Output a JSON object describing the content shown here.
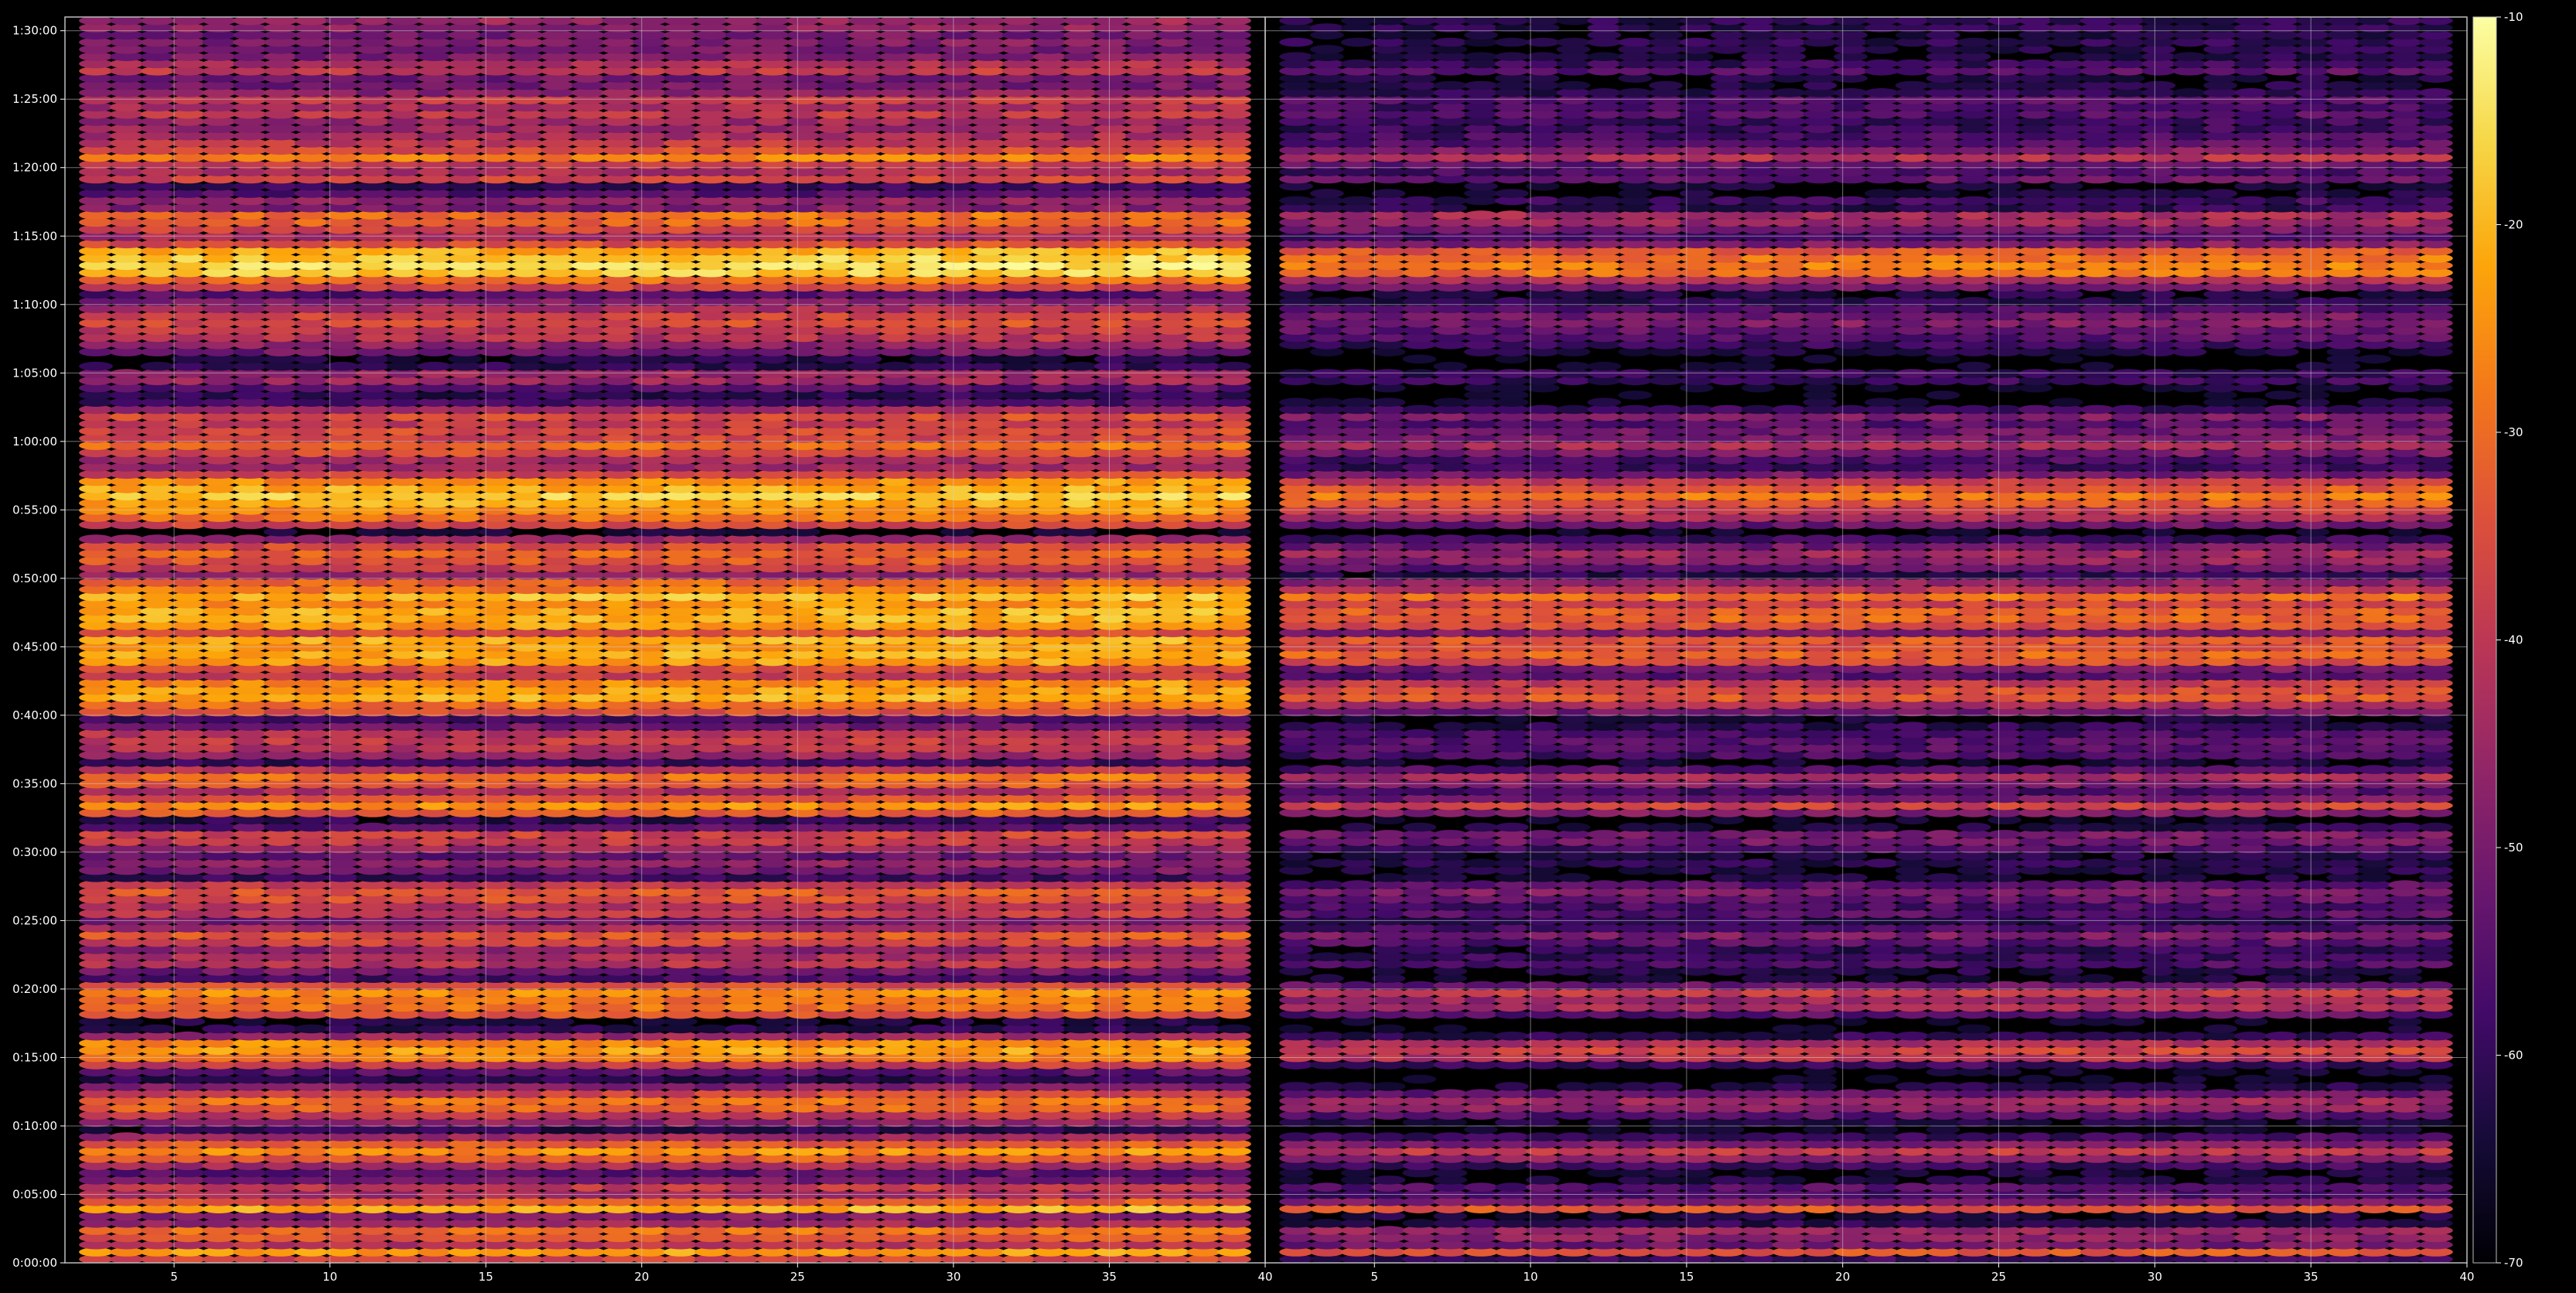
{
  "chart_data": {
    "type": "heatmap",
    "title": "",
    "xlabel": "",
    "ylabel": "",
    "colormap": "inferno",
    "grid": true,
    "colorbar": {
      "placement": "right",
      "range": [
        -70,
        -10
      ],
      "tick_labels": [
        "-10",
        "-20",
        "-30",
        "-40",
        "-50",
        "-60",
        "-70"
      ],
      "tick_values": [
        -10,
        -20,
        -30,
        -40,
        -50,
        -60,
        -70
      ]
    },
    "y_axis": {
      "range_minutes": [
        0,
        91
      ],
      "tick_minutes": [
        0,
        5,
        10,
        15,
        20,
        25,
        30,
        35,
        40,
        45,
        50,
        55,
        60,
        65,
        70,
        75,
        80,
        85,
        90
      ],
      "tick_labels": [
        "0:00:00",
        "0:05:00",
        "0:10:00",
        "0:15:00",
        "0:20:00",
        "0:25:00",
        "0:30:00",
        "0:35:00",
        "0:40:00",
        "0:45:00",
        "0:50:00",
        "0:55:00",
        "1:00:00",
        "1:05:00",
        "1:10:00",
        "1:15:00",
        "1:20:00",
        "1:25:00",
        "1:30:00"
      ]
    },
    "panels": [
      {
        "name": "",
        "x_range": [
          1.5,
          40
        ],
        "x_ticks": [
          5,
          10,
          15,
          20,
          25,
          30,
          35,
          40
        ],
        "x_tick_labels": [
          "5",
          "10",
          "15",
          "20",
          "25",
          "30",
          "35",
          "40"
        ],
        "channels": 38,
        "rows_level_dB": [
          -38,
          -24,
          -42,
          -34,
          -30,
          -46,
          -50,
          -22,
          -34,
          -44,
          -40,
          -52,
          -56,
          -44,
          -34,
          -26,
          -34,
          -46,
          -62,
          -48,
          -40,
          -32,
          -30,
          -38,
          -50,
          -62,
          -56,
          -40,
          -28,
          -24,
          -26,
          -46,
          -62,
          -64,
          -36,
          -30,
          -30,
          -26,
          -36,
          -58,
          -52,
          -42,
          -44,
          -48,
          -38,
          -34,
          -44,
          -52,
          -40,
          -42,
          -36,
          -34,
          -40,
          -60,
          -52,
          -48,
          -54,
          -46,
          -40,
          -38,
          -56,
          -62,
          -34,
          -26,
          -36,
          -44,
          -34,
          -30,
          -42,
          -60,
          -46,
          -42,
          -40,
          -42,
          -52,
          -58,
          -36,
          -30,
          -22,
          -24,
          -26,
          -40,
          -36,
          -24,
          -22,
          -24,
          -22,
          -36,
          -24,
          -22,
          -22,
          -26,
          -20,
          -28,
          -32,
          -48,
          -40,
          -34,
          -32,
          -36,
          -46,
          -66,
          -38,
          -30,
          -26,
          -22,
          -18,
          -22,
          -26,
          -38,
          -46,
          -44,
          -36,
          -30,
          -38,
          -36,
          -40,
          -36,
          -46,
          -58,
          -62,
          -56,
          -46,
          -46,
          -62,
          -64,
          -52,
          -48,
          -42,
          -40,
          -36,
          -38,
          -44,
          -50,
          -56,
          -38,
          -30,
          -18,
          -16,
          -18,
          -22,
          -36,
          -44,
          -38,
          -32,
          -30,
          -50,
          -48,
          -56,
          -60,
          -38,
          -44,
          -40,
          -28,
          -36,
          -40,
          -44,
          -46,
          -46,
          -40,
          -44,
          -40,
          -48,
          -52,
          -52,
          -40,
          -44,
          -50,
          -52,
          -50,
          -52,
          -48,
          -46
        ]
      },
      {
        "name": "",
        "x_range": [
          1.5,
          40
        ],
        "x_ticks": [
          5,
          10,
          15,
          20,
          25,
          30,
          35,
          40
        ],
        "x_tick_labels": [
          "5",
          "10",
          "15",
          "20",
          "25",
          "30",
          "35",
          "40"
        ],
        "channels": 38,
        "rows_level_dB": [
          -60,
          -34,
          -52,
          -48,
          -46,
          -62,
          -64,
          -34,
          -50,
          -58,
          -56,
          -64,
          -66,
          -60,
          -48,
          -40,
          -50,
          -60,
          -68,
          -64,
          -56,
          -48,
          -46,
          -54,
          -64,
          -68,
          -68,
          -60,
          -42,
          -38,
          -44,
          -62,
          -68,
          -68,
          -56,
          -44,
          -46,
          -40,
          -54,
          -66,
          -64,
          -58,
          -60,
          -62,
          -56,
          -50,
          -58,
          -62,
          -56,
          -58,
          -54,
          -50,
          -56,
          -66,
          -64,
          -62,
          -64,
          -58,
          -52,
          -52,
          -64,
          -68,
          -50,
          -38,
          -52,
          -58,
          -50,
          -44,
          -56,
          -66,
          -58,
          -56,
          -56,
          -58,
          -62,
          -66,
          -52,
          -44,
          -34,
          -36,
          -40,
          -56,
          -52,
          -36,
          -32,
          -36,
          -34,
          -50,
          -36,
          -32,
          -32,
          -38,
          -30,
          -42,
          -48,
          -62,
          -54,
          -48,
          -46,
          -52,
          -60,
          -68,
          -54,
          -44,
          -40,
          -34,
          -28,
          -34,
          -40,
          -52,
          -60,
          -58,
          -52,
          -44,
          -52,
          -52,
          -56,
          -50,
          -60,
          -66,
          -68,
          -66,
          -60,
          -60,
          -68,
          -68,
          -64,
          -60,
          -56,
          -54,
          -50,
          -52,
          -58,
          -62,
          -64,
          -52,
          -44,
          -30,
          -28,
          -30,
          -34,
          -50,
          -58,
          -52,
          -46,
          -44,
          -62,
          -60,
          -66,
          -66,
          -54,
          -58,
          -54,
          -42,
          -50,
          -56,
          -58,
          -60,
          -60,
          -56,
          -58,
          -56,
          -62,
          -64,
          -64,
          -56,
          -60,
          -64,
          -64,
          -62,
          -64,
          -62,
          -62
        ]
      }
    ]
  }
}
